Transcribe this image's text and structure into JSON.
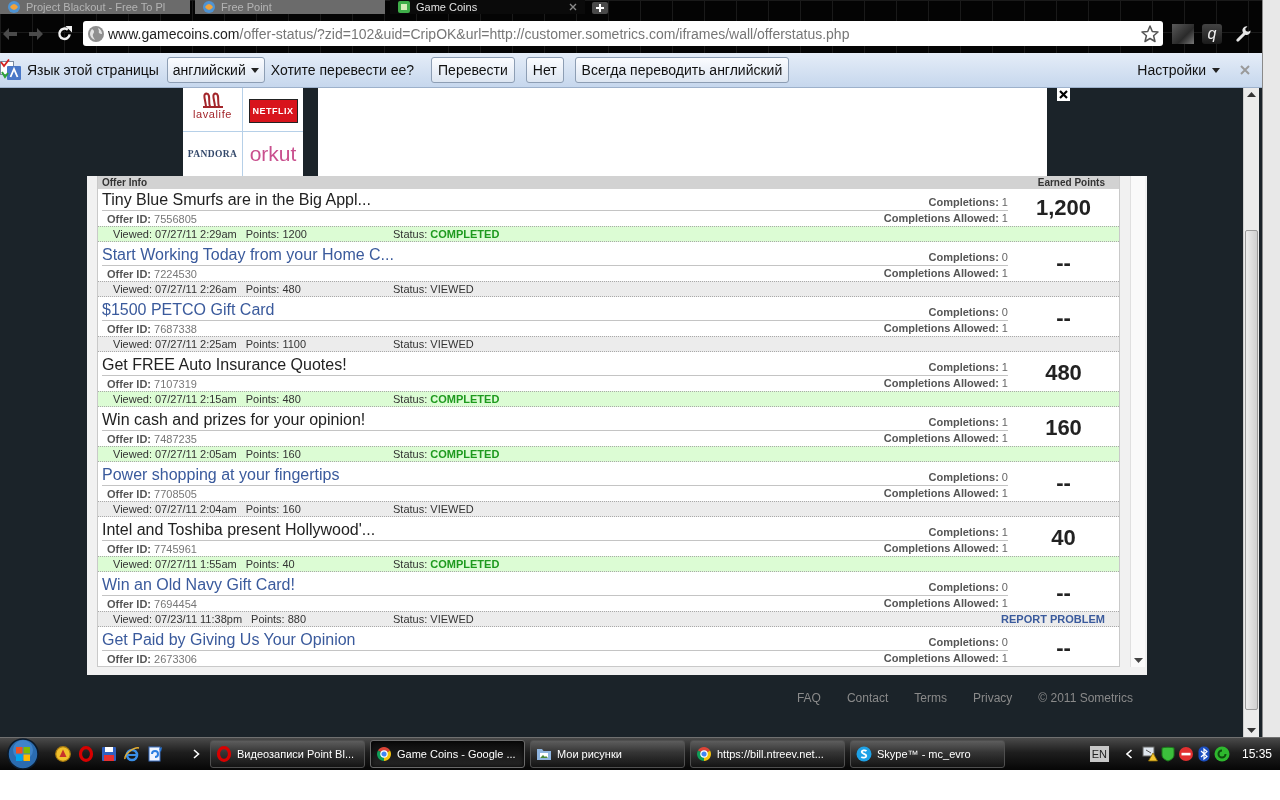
{
  "browser": {
    "tabs": [
      {
        "title": "Project Blackout - Free To Pl",
        "kind": "swirl",
        "selected": false
      },
      {
        "title": "Free Point",
        "kind": "swirl",
        "selected": false
      },
      {
        "title": "Game Coins",
        "kind": "tile",
        "selected": true
      }
    ],
    "nav": {
      "back_disabled": true,
      "forward_disabled": true
    },
    "address": {
      "host": "www.gamecoins.com",
      "path": "/offer-status/?zid=102&uid=CripOK&url=http://customer.sometrics.com/iframes/wall/offerstatus.php"
    },
    "extension_letter": "q"
  },
  "translate_bar": {
    "prompt": "Язык этой страницы",
    "language": "английский",
    "question": "Хотите перевести ее?",
    "buttons": [
      "Перевести",
      "Нет",
      "Всегда переводить английский"
    ],
    "options": "Настройки"
  },
  "ad": {
    "logos": [
      {
        "text": "lavalife",
        "kind": "emblem",
        "color": "#a3262b"
      },
      {
        "text": "NETFLIX",
        "kind": "boxed",
        "color": "#d8141c"
      },
      {
        "text": "PANDORA",
        "kind": "caps",
        "color": "#34496b"
      },
      {
        "text": "orkut",
        "kind": "script",
        "color": "#c9508e"
      }
    ]
  },
  "offers": {
    "columns": [
      "Offer Info",
      "Earned Points"
    ],
    "rows": [
      {
        "title": "Tiny Blue Smurfs are in the Big Appl...",
        "completed": true,
        "completions": "**Completions:** 1",
        "offer_id": "**Offer ID:** 7556805",
        "allowed": "**Completions Allowed:** 1",
        "earned": "1,200",
        "viewed": "Viewed: 07/27/11 2:29am",
        "points": "Points: 1200",
        "status": "Status: **COMPLETED**"
      },
      {
        "title": "Start Working Today from your Home C...",
        "completed": false,
        "completions": "**Completions:** 0",
        "offer_id": "**Offer ID:** 7224530",
        "allowed": "**Completions Allowed:** 1",
        "earned": "--",
        "viewed": "Viewed: 07/27/11 2:26am",
        "points": "Points: 480",
        "status": "Status: VIEWED"
      },
      {
        "title": "$1500 PETCO Gift Card",
        "completed": false,
        "completions": "**Completions:** 0",
        "offer_id": "**Offer ID:** 7687338",
        "allowed": "**Completions Allowed:** 1",
        "earned": "--",
        "viewed": "Viewed: 07/27/11 2:25am",
        "points": "Points: 1100",
        "status": "Status: VIEWED"
      },
      {
        "title": "Get FREE Auto Insurance Quotes!",
        "completed": true,
        "completions": "**Completions:** 1",
        "offer_id": "**Offer ID:** 7107319",
        "allowed": "**Completions Allowed:** 1",
        "earned": "480",
        "viewed": "Viewed: 07/27/11 2:15am",
        "points": "Points: 480",
        "status": "Status: **COMPLETED**"
      },
      {
        "title": "Win cash and prizes for your opinion!",
        "completed": true,
        "completions": "**Completions:** 1",
        "offer_id": "**Offer ID:** 7487235",
        "allowed": "**Completions Allowed:** 1",
        "earned": "160",
        "viewed": "Viewed: 07/27/11 2:05am",
        "points": "Points: 160",
        "status": "Status: **COMPLETED**"
      },
      {
        "title": "Power shopping at your fingertips",
        "completed": false,
        "completions": "**Completions:** 0",
        "offer_id": "**Offer ID:** 7708505",
        "allowed": "**Completions Allowed:** 1",
        "earned": "--",
        "viewed": "Viewed: 07/27/11 2:04am",
        "points": "Points: 160",
        "status": "Status: VIEWED"
      },
      {
        "title": "Intel and Toshiba present Hollywood'...",
        "completed": true,
        "completions": "**Completions:** 1",
        "offer_id": "**Offer ID:** 7745961",
        "allowed": "**Completions Allowed:** 1",
        "earned": "40",
        "viewed": "Viewed: 07/27/11 1:55am",
        "points": "Points: 40",
        "status": "Status: **COMPLETED**"
      },
      {
        "title": "Win an Old Navy Gift Card!",
        "completed": false,
        "completions": "**Completions:** 0",
        "offer_id": "**Offer ID:** 7694454",
        "allowed": "**Completions Allowed:** 1",
        "earned": "--",
        "viewed": "Viewed: 07/23/11 11:38pm",
        "points": "Points: 880",
        "status": "Status: VIEWED",
        "report": "REPORT PROBLEM"
      },
      {
        "title": "Get Paid by Giving Us Your Opinion",
        "completed": false,
        "completions": "**Completions:** 0",
        "offer_id": "**Offer ID:** 2673306",
        "allowed": "**Completions Allowed:** 1",
        "earned": "--"
      }
    ]
  },
  "footer": {
    "links": [
      "FAQ",
      "Contact",
      "Terms",
      "Privacy"
    ],
    "copyright": "© 2011 Sometrics"
  },
  "taskbar": {
    "tasks": [
      {
        "title": "Видеозаписи Point Bl...",
        "kind": "ring",
        "selected": false
      },
      {
        "title": "Game Coins - Google ...",
        "kind": "wheel",
        "selected": true
      },
      {
        "title": "Мои рисунки",
        "kind": "folder",
        "selected": false
      },
      {
        "title": "https://bill.ntreev.net...",
        "kind": "wheel",
        "selected": false
      },
      {
        "title": "Skype™ - mc_evro",
        "kind": "cloud",
        "selected": false
      }
    ],
    "language": "EN",
    "clock": "15:35"
  }
}
